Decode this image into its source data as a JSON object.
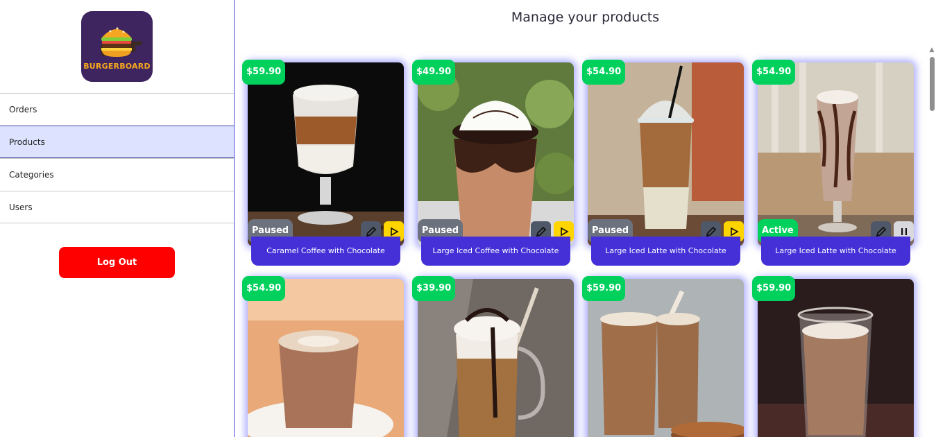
{
  "app": {
    "logo_text": "BURGERBOARD",
    "logo_icon": "burger-icon"
  },
  "sidebar": {
    "items": [
      {
        "label": "Orders",
        "active": false
      },
      {
        "label": "Products",
        "active": true
      },
      {
        "label": "Categories",
        "active": false
      },
      {
        "label": "Users",
        "active": false
      }
    ],
    "logout_label": "Log Out"
  },
  "main": {
    "title": "Manage your products"
  },
  "products": [
    {
      "price": "$59.90",
      "status": "Paused",
      "name": "Caramel Coffee with Chocolate",
      "toggle_icon": "play-icon"
    },
    {
      "price": "$49.90",
      "status": "Paused",
      "name": "Large Iced Coffee with Chocolate",
      "toggle_icon": "play-icon"
    },
    {
      "price": "$54.90",
      "status": "Paused",
      "name": "Large Iced Latte with Chocolate",
      "toggle_icon": "play-icon"
    },
    {
      "price": "$54.90",
      "status": "Active",
      "name": "Large Iced Latte with Chocolate",
      "toggle_icon": "pause-icon"
    },
    {
      "price": "$54.90"
    },
    {
      "price": "$39.90"
    },
    {
      "price": "$59.90"
    },
    {
      "price": "$59.90"
    }
  ],
  "colors": {
    "accent": "#4530d8",
    "price_badge": "#00d15c",
    "logout": "#ff0000",
    "active_nav": "#dde3ff",
    "play_button": "#ffd500",
    "paused_badge": "#6c717e"
  }
}
